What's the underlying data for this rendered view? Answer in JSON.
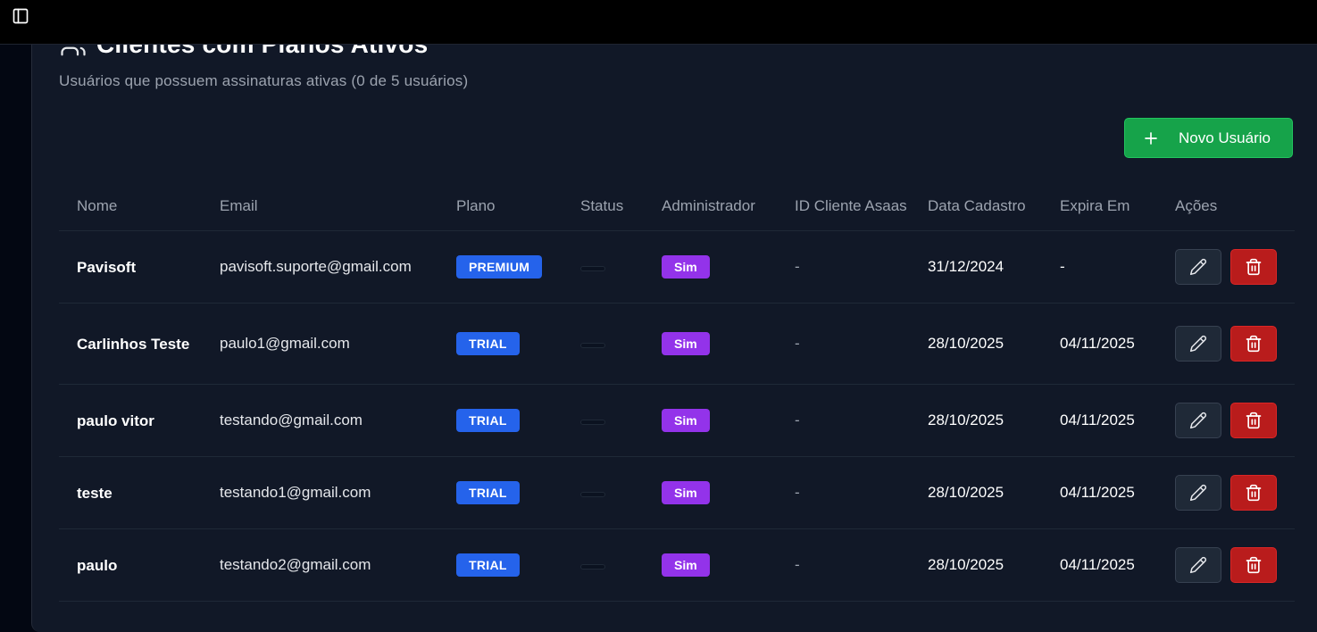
{
  "header": {
    "title": "Clientes com Planos Ativos",
    "subtitle": "Usuários que possuem assinaturas ativas (0 de 5 usuários)",
    "new_user_label": "Novo Usuário"
  },
  "table": {
    "columns": {
      "nome": "Nome",
      "email": "Email",
      "plano": "Plano",
      "status": "Status",
      "admin": "Administrador",
      "asaas": "ID Cliente Asaas",
      "cadastro": "Data Cadastro",
      "expira": "Expira Em",
      "acoes": "Ações"
    },
    "rows": [
      {
        "nome": "Pavisoft",
        "email": "pavisoft.suporte@gmail.com",
        "plano": "PREMIUM",
        "admin": "Sim",
        "asaas": "-",
        "cadastro": "31/12/2024",
        "expira": "-"
      },
      {
        "nome": "Carlinhos Teste",
        "email": "paulo1@gmail.com",
        "plano": "TRIAL",
        "admin": "Sim",
        "asaas": "-",
        "cadastro": "28/10/2025",
        "expira": "04/11/2025"
      },
      {
        "nome": "paulo vitor",
        "email": "testando@gmail.com",
        "plano": "TRIAL",
        "admin": "Sim",
        "asaas": "-",
        "cadastro": "28/10/2025",
        "expira": "04/11/2025"
      },
      {
        "nome": "teste",
        "email": "testando1@gmail.com",
        "plano": "TRIAL",
        "admin": "Sim",
        "asaas": "-",
        "cadastro": "28/10/2025",
        "expira": "04/11/2025"
      },
      {
        "nome": "paulo",
        "email": "testando2@gmail.com",
        "plano": "TRIAL",
        "admin": "Sim",
        "asaas": "-",
        "cadastro": "28/10/2025",
        "expira": "04/11/2025"
      }
    ]
  },
  "icons": {
    "sidebar_toggle": "panel-left-icon",
    "title": "users-icon",
    "new_user": "plus-icon",
    "edit": "pencil-icon",
    "delete": "trash-icon"
  },
  "colors": {
    "background": "#111827",
    "accent_green": "#16a34a",
    "plan_badge": "#2563eb",
    "admin_badge": "#9333ea",
    "delete_red": "#b91c1c"
  }
}
